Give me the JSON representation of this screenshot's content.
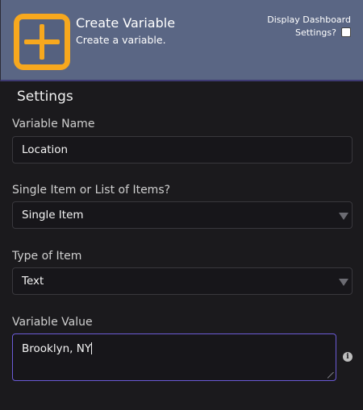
{
  "header": {
    "title": "Create Variable",
    "subtitle": "Create a variable.",
    "dashboard_toggle_label_line1": "Display Dashboard",
    "dashboard_toggle_label_line2": "Settings?",
    "dashboard_toggle_checked": false,
    "icon": "plus-square-icon",
    "icon_color": "#f7a81e"
  },
  "section": {
    "title": "Settings"
  },
  "fields": {
    "variable_name": {
      "label": "Variable Name",
      "value": "Location"
    },
    "item_mode": {
      "label": "Single Item or List of Items?",
      "selected": "Single Item"
    },
    "item_type": {
      "label": "Type of Item",
      "selected": "Text"
    },
    "variable_value": {
      "label": "Variable Value",
      "value": "Brooklyn, NY",
      "info_icon": "info-icon"
    }
  },
  "colors": {
    "header_bg": "#5a6684",
    "body_bg": "#1b1a1d",
    "focus_border": "#6b5bd6"
  }
}
